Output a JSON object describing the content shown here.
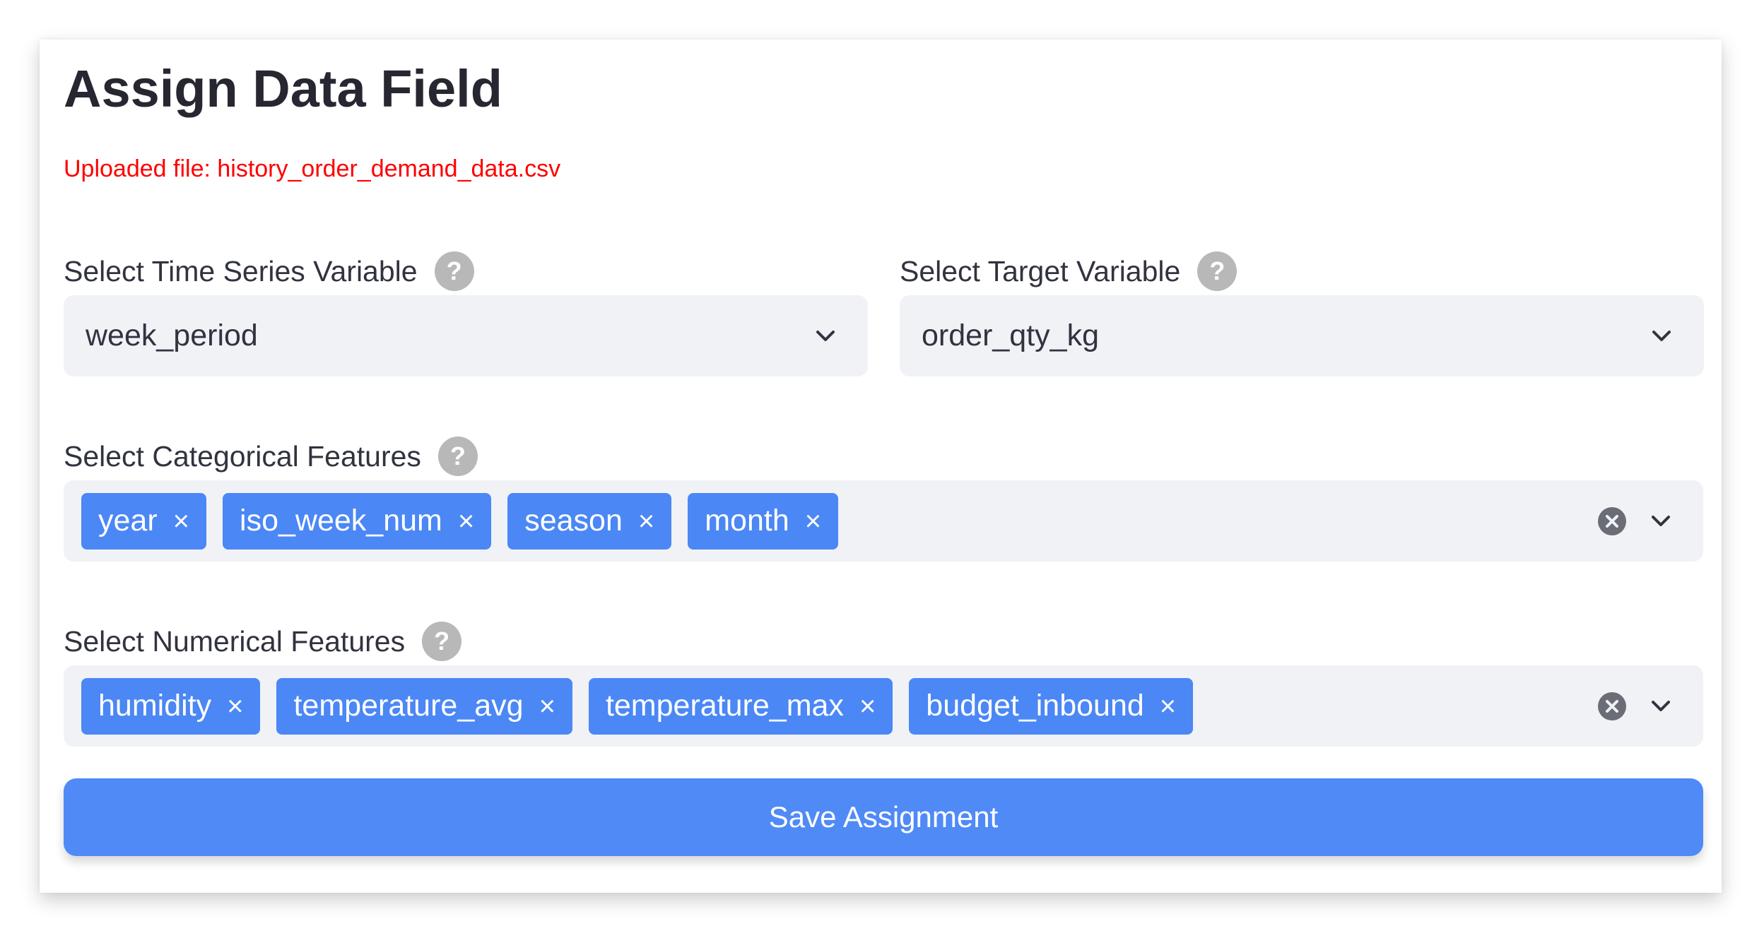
{
  "page": {
    "title": "Assign Data Field",
    "uploaded_file_text": "Uploaded file: history_order_demand_data.csv"
  },
  "time_series": {
    "label": "Select Time Series Variable",
    "help": "?",
    "value": "week_period"
  },
  "target": {
    "label": "Select Target Variable",
    "help": "?",
    "value": "order_qty_kg"
  },
  "categorical": {
    "label": "Select Categorical Features",
    "help": "?",
    "tags": [
      "year",
      "iso_week_num",
      "season",
      "month"
    ]
  },
  "numerical": {
    "label": "Select Numerical Features",
    "help": "?",
    "tags": [
      "humidity",
      "temperature_avg",
      "temperature_max",
      "budget_inbound"
    ]
  },
  "tag_remove_glyph": "×",
  "save_button_label": "Save Assignment",
  "colors": {
    "accent": "#4f8af7",
    "tag": "#4b87f5",
    "warning_text": "#ff0000",
    "input_bg": "#f0f2f6",
    "help_icon": "#b8b8b8"
  },
  "icons": {
    "help": "question-circle-icon",
    "dropdown": "chevron-down-icon",
    "clear": "clear-all-icon",
    "tag_remove": "close-icon"
  }
}
